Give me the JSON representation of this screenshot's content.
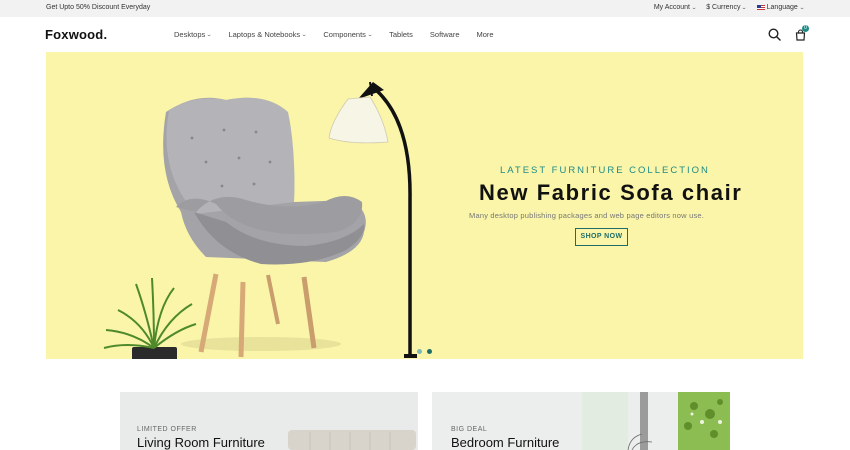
{
  "topbar": {
    "promo": "Get Upto 50% Discount Everyday",
    "account_label": "My Account",
    "currency_label": "$ Currency",
    "language_label": "Language"
  },
  "header": {
    "logo": "Foxwood.",
    "nav": [
      {
        "label": "Desktops",
        "has_dropdown": true
      },
      {
        "label": "Laptops & Notebooks",
        "has_dropdown": true
      },
      {
        "label": "Components",
        "has_dropdown": true
      },
      {
        "label": "Tablets",
        "has_dropdown": false
      },
      {
        "label": "Software",
        "has_dropdown": false
      },
      {
        "label": "More",
        "has_dropdown": false
      }
    ],
    "cart_count": "0",
    "icons": [
      "search-icon",
      "cart-icon"
    ]
  },
  "hero": {
    "kicker": "LATEST FURNITURE COLLECTION",
    "title": "New Fabric Sofa chair",
    "description": "Many desktop publishing packages and web page editors now use.",
    "cta": "SHOP NOW",
    "slide_count": 2,
    "active_slide": 2
  },
  "banners": [
    {
      "tag": "LIMITED OFFER",
      "title": "Living Room Furniture"
    },
    {
      "tag": "BIG DEAL",
      "title": "Bedroom Furniture"
    }
  ],
  "colors": {
    "accent": "#1e8b85",
    "hero_bg": "#faf5a9",
    "topbar_bg": "#f2f2f2"
  }
}
